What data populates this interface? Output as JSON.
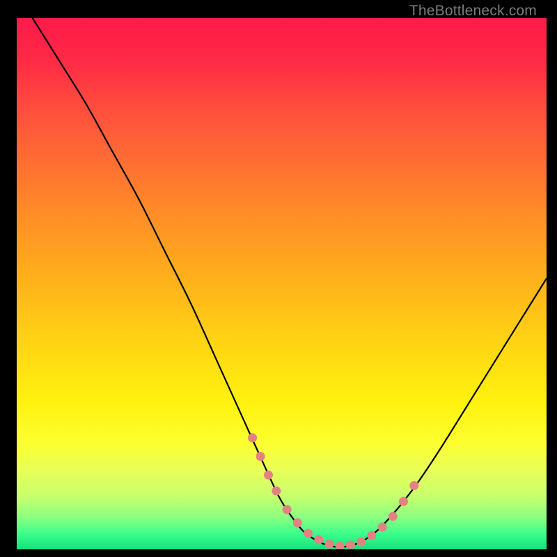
{
  "watermark": "TheBottleneck.com",
  "colors": {
    "curve_stroke": "#000000",
    "dot_fill": "#e28282",
    "background_black": "#000000"
  },
  "chart_data": {
    "type": "line",
    "title": "",
    "xlabel": "",
    "ylabel": "",
    "xlim": [
      0,
      100
    ],
    "ylim": [
      0,
      100
    ],
    "grid": false,
    "legend": false,
    "series": [
      {
        "name": "bottleneck-curve",
        "x": [
          3,
          8,
          13,
          18,
          23,
          28,
          33,
          38,
          43,
          48,
          50,
          52,
          54,
          56,
          58,
          60,
          62,
          64,
          66,
          68,
          70,
          73,
          76,
          80,
          85,
          90,
          95,
          100
        ],
        "y": [
          100,
          92,
          84,
          75,
          66,
          56,
          46,
          35,
          24,
          13,
          9,
          6,
          3.5,
          2,
          1,
          0.5,
          0.5,
          1,
          2,
          3.5,
          5.5,
          9,
          13,
          19,
          27,
          35,
          43,
          51
        ]
      }
    ],
    "highlight_dots": {
      "name": "near-zero-band",
      "x": [
        44.5,
        46,
        47.5,
        49,
        51,
        53,
        55,
        57,
        59,
        61,
        63,
        65,
        67,
        69,
        71,
        73,
        75
      ],
      "y": [
        21,
        17.5,
        14,
        11,
        7.5,
        5,
        3,
        1.8,
        1,
        0.6,
        0.8,
        1.4,
        2.6,
        4.2,
        6.2,
        9,
        12
      ]
    }
  }
}
